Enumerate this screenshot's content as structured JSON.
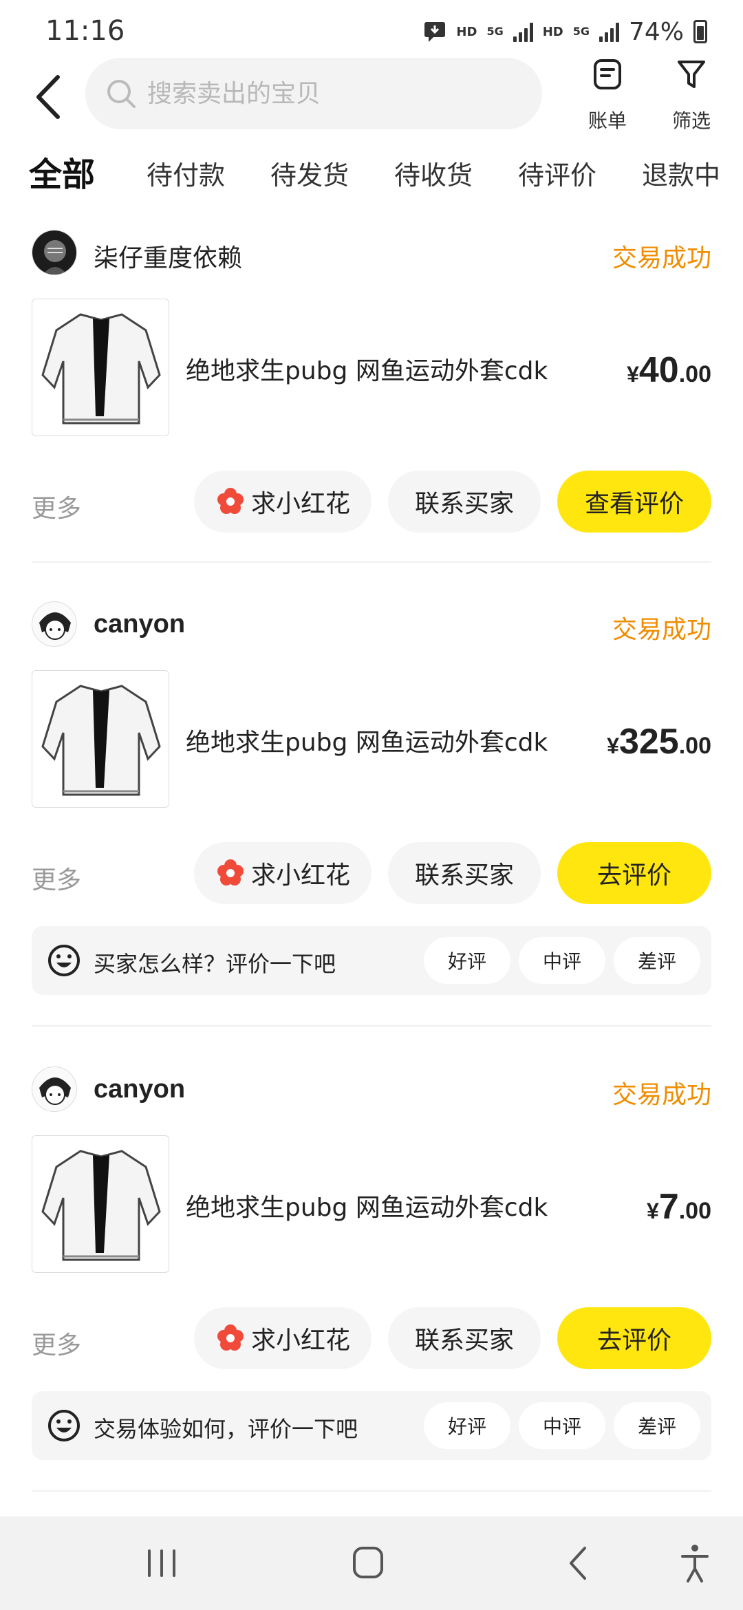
{
  "status_bar": {
    "time": "11:16",
    "hd1": "HD",
    "net1": "5G",
    "hd2": "HD",
    "net2": "5G",
    "battery": "74%"
  },
  "header": {
    "search_placeholder": "搜索卖出的宝贝",
    "bill_label": "账单",
    "filter_label": "筛选"
  },
  "tabs": [
    "全部",
    "待付款",
    "待发货",
    "待收货",
    "待评价",
    "退款中"
  ],
  "colors": {
    "accent": "#ffe60f",
    "status": "#f08c00",
    "muted": "#999999"
  },
  "orders": [
    {
      "buyer": "柒仔重度依赖",
      "status": "交易成功",
      "title": "绝地求生pubg 网鱼运动外套cdk",
      "currency": "¥",
      "price_int": "40",
      "price_dec": ".00",
      "more": "更多",
      "flower": "求小红花",
      "contact": "联系买家",
      "primary": "查看评价"
    },
    {
      "buyer": "canyon",
      "status": "交易成功",
      "title": "绝地求生pubg 网鱼运动外套cdk",
      "currency": "¥",
      "price_int": "325",
      "price_dec": ".00",
      "more": "更多",
      "flower": "求小红花",
      "contact": "联系买家",
      "primary": "去评价",
      "review_prompt": "买家怎么样？评价一下吧",
      "rates": [
        "好评",
        "中评",
        "差评"
      ]
    },
    {
      "buyer": "canyon",
      "status": "交易成功",
      "title": "绝地求生pubg 网鱼运动外套cdk",
      "currency": "¥",
      "price_int": "7",
      "price_dec": ".00",
      "more": "更多",
      "flower": "求小红花",
      "contact": "联系买家",
      "primary": "去评价",
      "review_prompt": "交易体验如何，评价一下吧",
      "rates": [
        "好评",
        "中评",
        "差评"
      ]
    }
  ]
}
